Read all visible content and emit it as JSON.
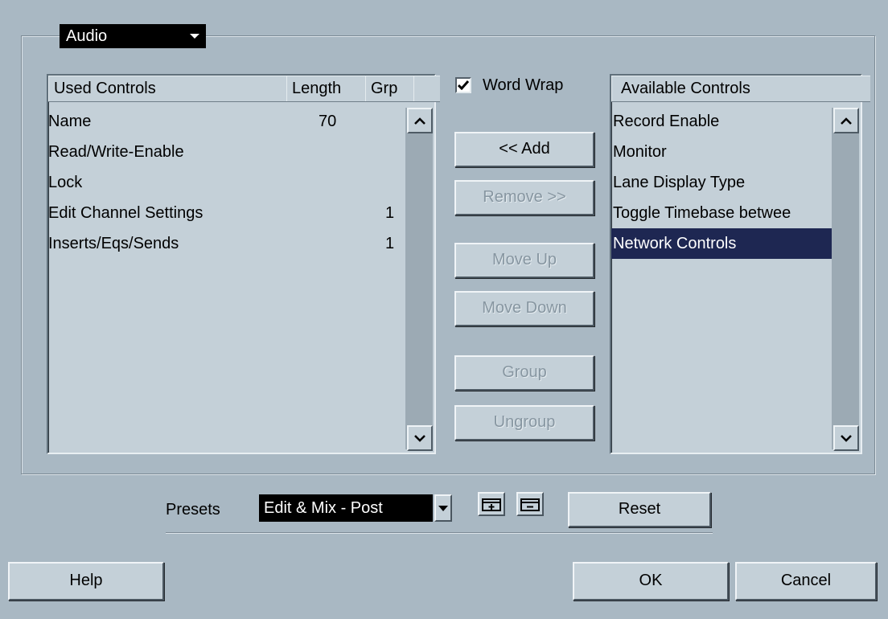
{
  "track_type": {
    "selected": "Audio",
    "icon": "chevron-down-icon"
  },
  "used_controls": {
    "headers": {
      "name": "Used Controls",
      "length": "Length",
      "grp": "Grp"
    },
    "rows": [
      {
        "name": "Name",
        "length": "70",
        "grp": ""
      },
      {
        "name": "Read/Write-Enable",
        "length": "",
        "grp": ""
      },
      {
        "name": "Lock",
        "length": "",
        "grp": ""
      },
      {
        "name": "Edit Channel Settings",
        "length": "",
        "grp": "1"
      },
      {
        "name": "Inserts/Eqs/Sends",
        "length": "",
        "grp": "1"
      }
    ]
  },
  "word_wrap": {
    "label": "Word Wrap",
    "checked": true
  },
  "buttons": {
    "add": "<< Add",
    "remove": "Remove >>",
    "move_up": "Move Up",
    "move_down": "Move Down",
    "group": "Group",
    "ungroup": "Ungroup"
  },
  "available_controls": {
    "header": "Available Controls",
    "items": [
      {
        "label": "Record Enable",
        "selected": false
      },
      {
        "label": "Monitor",
        "selected": false
      },
      {
        "label": "Lane Display Type",
        "selected": false
      },
      {
        "label": "Toggle Timebase betwee",
        "selected": false
      },
      {
        "label": "Network Controls",
        "selected": true
      }
    ]
  },
  "presets": {
    "label": "Presets",
    "selected": "Edit & Mix - Post",
    "save_icon": "save-preset-icon",
    "delete_icon": "delete-preset-icon",
    "reset_label": "Reset"
  },
  "footer": {
    "help": "Help",
    "ok": "OK",
    "cancel": "Cancel"
  },
  "colors": {
    "background": "#a9b8c3",
    "selection": "#1e2752",
    "dropdown": "#000000"
  }
}
